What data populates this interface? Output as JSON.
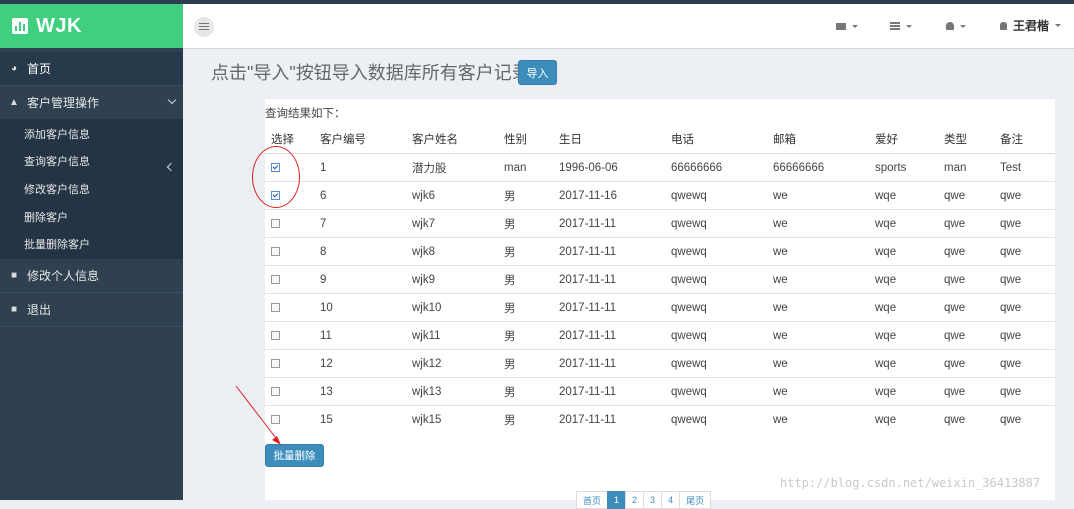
{
  "app": {
    "logo_text": "WJK"
  },
  "sidebar": {
    "home": "首页",
    "customer_mgmt": "客户管理操作",
    "sub_items": [
      "添加客户信息",
      "查询客户信息",
      "修改客户信息",
      "删除客户",
      "批量删除客户"
    ],
    "edit_profile": "修改个人信息",
    "logout": "退出"
  },
  "header": {
    "user_name": "王君楷"
  },
  "main": {
    "title": "点击\"导入\"按钮导入数据库所有客户记录",
    "import_label": "导入",
    "result_title": "查询结果如下：",
    "batch_delete_label": "批量删除"
  },
  "table": {
    "headers": [
      "选择",
      "客户编号",
      "客户姓名",
      "性别",
      "生日",
      "电话",
      "邮箱",
      "爱好",
      "类型",
      "备注"
    ],
    "rows": [
      {
        "checked": true,
        "cells": [
          "1",
          "潜力股",
          "man",
          "1996-06-06",
          "66666666",
          "66666666",
          "sports",
          "man",
          "Test"
        ]
      },
      {
        "checked": true,
        "cells": [
          "6",
          "wjk6",
          "男",
          "2017-11-16",
          "qwewq",
          "we",
          "wqe",
          "qwe",
          "qwe"
        ]
      },
      {
        "checked": false,
        "cells": [
          "7",
          "wjk7",
          "男",
          "2017-11-11",
          "qwewq",
          "we",
          "wqe",
          "qwe",
          "qwe"
        ]
      },
      {
        "checked": false,
        "cells": [
          "8",
          "wjk8",
          "男",
          "2017-11-11",
          "qwewq",
          "we",
          "wqe",
          "qwe",
          "qwe"
        ]
      },
      {
        "checked": false,
        "cells": [
          "9",
          "wjk9",
          "男",
          "2017-11-11",
          "qwewq",
          "we",
          "wqe",
          "qwe",
          "qwe"
        ]
      },
      {
        "checked": false,
        "cells": [
          "10",
          "wjk10",
          "男",
          "2017-11-11",
          "qwewq",
          "we",
          "wqe",
          "qwe",
          "qwe"
        ]
      },
      {
        "checked": false,
        "cells": [
          "11",
          "wjk11",
          "男",
          "2017-11-11",
          "qwewq",
          "we",
          "wqe",
          "qwe",
          "qwe"
        ]
      },
      {
        "checked": false,
        "cells": [
          "12",
          "wjk12",
          "男",
          "2017-11-11",
          "qwewq",
          "we",
          "wqe",
          "qwe",
          "qwe"
        ]
      },
      {
        "checked": false,
        "cells": [
          "13",
          "wjk13",
          "男",
          "2017-11-11",
          "qwewq",
          "we",
          "wqe",
          "qwe",
          "qwe"
        ]
      },
      {
        "checked": false,
        "cells": [
          "15",
          "wjk15",
          "男",
          "2017-11-11",
          "qwewq",
          "we",
          "wqe",
          "qwe",
          "qwe"
        ]
      }
    ]
  },
  "pagination": {
    "first": "首页",
    "pages": [
      "1",
      "2",
      "3",
      "4"
    ],
    "last": "尾页",
    "current": "1"
  },
  "watermark": "http://blog.csdn.net/weixin_36413887",
  "icons": {
    "logo": "bar-chart-icon",
    "home": "dashboard-icon",
    "customer": "sitemap-icon",
    "profile": "file-icon",
    "logout": "file-icon",
    "mail": "envelope-icon",
    "tasks": "server-icon",
    "alerts": "bell-icon",
    "user": "user-icon"
  },
  "colors": {
    "brand": "#3fcf7f",
    "sidebar": "#2f4050",
    "primary": "#3c8dbc",
    "annotation": "#dd2222"
  }
}
